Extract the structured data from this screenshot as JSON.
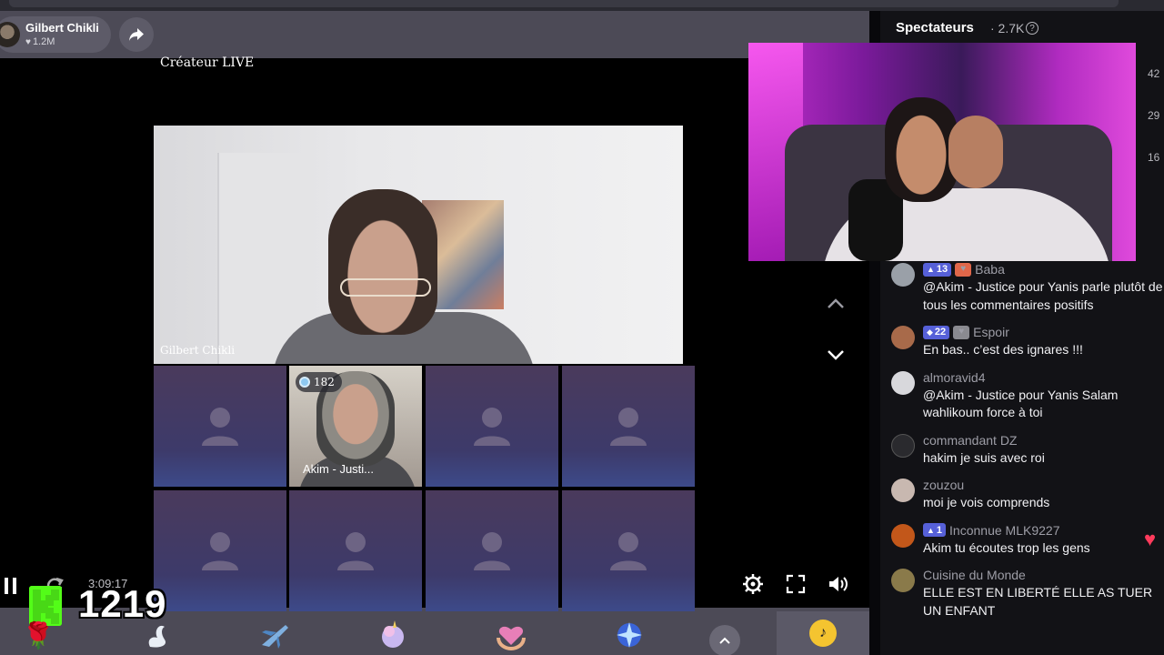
{
  "host": {
    "name": "Gilbert Chikli",
    "likes": "1.2M"
  },
  "live": {
    "creator_label": "Créateur LIVE",
    "host_video_name": "Gilbert Chikli",
    "guest": {
      "badge_count": "182",
      "name": "Akim - Justi..."
    }
  },
  "player": {
    "timecode": "3:09:17",
    "kick_count": "1219"
  },
  "chat": {
    "title": "Spectateurs",
    "viewer_count": "· 2.7K",
    "edge_numbers": [
      "42",
      "29",
      "16"
    ],
    "messages": [
      {
        "level": "13",
        "user": "Baba",
        "text": "@Akim - Justice pour Yanis parle plutôt de tous les commentaires positifs",
        "avatar_color": "#9aa0a8",
        "fan_color": "#e0674a"
      },
      {
        "level": "22",
        "user": "Espoir",
        "text": "En bas.. c’est des ignares !!!",
        "avatar_color": "#a86a4a",
        "fan_color": "#8a8a90"
      },
      {
        "level": "",
        "user": "almoravid4",
        "text": "@Akim - Justice pour Yanis Salam wahlikoum force à toi",
        "avatar_color": "#d8d8dc",
        "fan_color": ""
      },
      {
        "level": "",
        "user": "commandant DZ",
        "text": "hakim je suis avec roi",
        "avatar_color": "#2a2a2e",
        "fan_color": ""
      },
      {
        "level": "",
        "user": "zouzou",
        "text": "moi je vois comprends",
        "avatar_color": "#c8b8b0",
        "fan_color": ""
      },
      {
        "level": "1",
        "user": "Inconnue MLK9227",
        "text": "Akim tu écoutes trop les gens",
        "avatar_color": "#c2571a",
        "fan_color": ""
      },
      {
        "level": "",
        "user": "Cuisine du Monde",
        "text": "ELLE EST EN LIBERTÉ ELLE AS TUER UN ENFANT",
        "avatar_color": "#8a7a4a",
        "fan_color": ""
      }
    ]
  },
  "colors": {
    "panel": "#4c4a56",
    "chat_bg": "#121216",
    "level_badge": "#5660d8",
    "kick_green": "#53fc18",
    "like_heart": "#ff3b5c"
  },
  "icons": [
    "share-icon",
    "chevron-up-icon",
    "chevron-down-icon",
    "settings-icon",
    "fullscreen-icon",
    "volume-icon",
    "pause-icon",
    "replay-icon",
    "help-icon",
    "tiktok-icon"
  ],
  "gifts": [
    "rose-gift",
    "swan-gift",
    "jet-gift",
    "unicorn-gift",
    "heart-hands-gift",
    "galaxy-gift"
  ]
}
